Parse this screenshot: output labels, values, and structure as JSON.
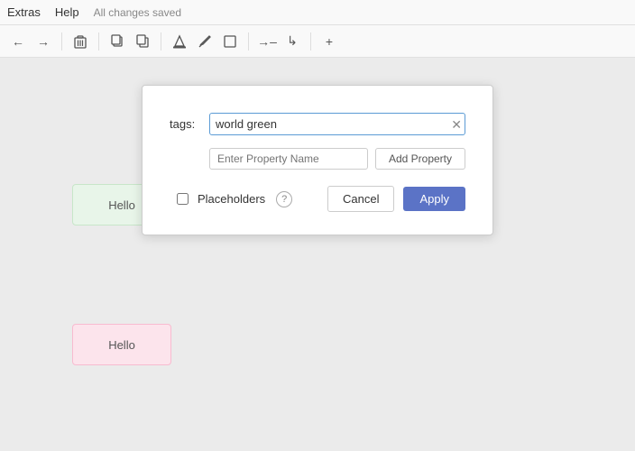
{
  "menubar": {
    "extras": "Extras",
    "help": "Help",
    "status": "All changes saved"
  },
  "toolbar": {
    "icons": [
      "undo",
      "redo",
      "trash",
      "copy",
      "duplicate",
      "fill",
      "pencil",
      "rect",
      "arrow-right",
      "corner-arrow",
      "plus"
    ]
  },
  "canvas": {
    "boxes": [
      {
        "label": "Hello",
        "style": "green"
      },
      {
        "label": "Hello",
        "style": "pink"
      }
    ]
  },
  "dialog": {
    "tags_label": "tags:",
    "tags_value": "world green",
    "property_name_placeholder": "Enter Property Name",
    "add_property_label": "Add Property",
    "placeholders_label": "Placeholders",
    "help_icon": "?",
    "cancel_label": "Cancel",
    "apply_label": "Apply"
  }
}
